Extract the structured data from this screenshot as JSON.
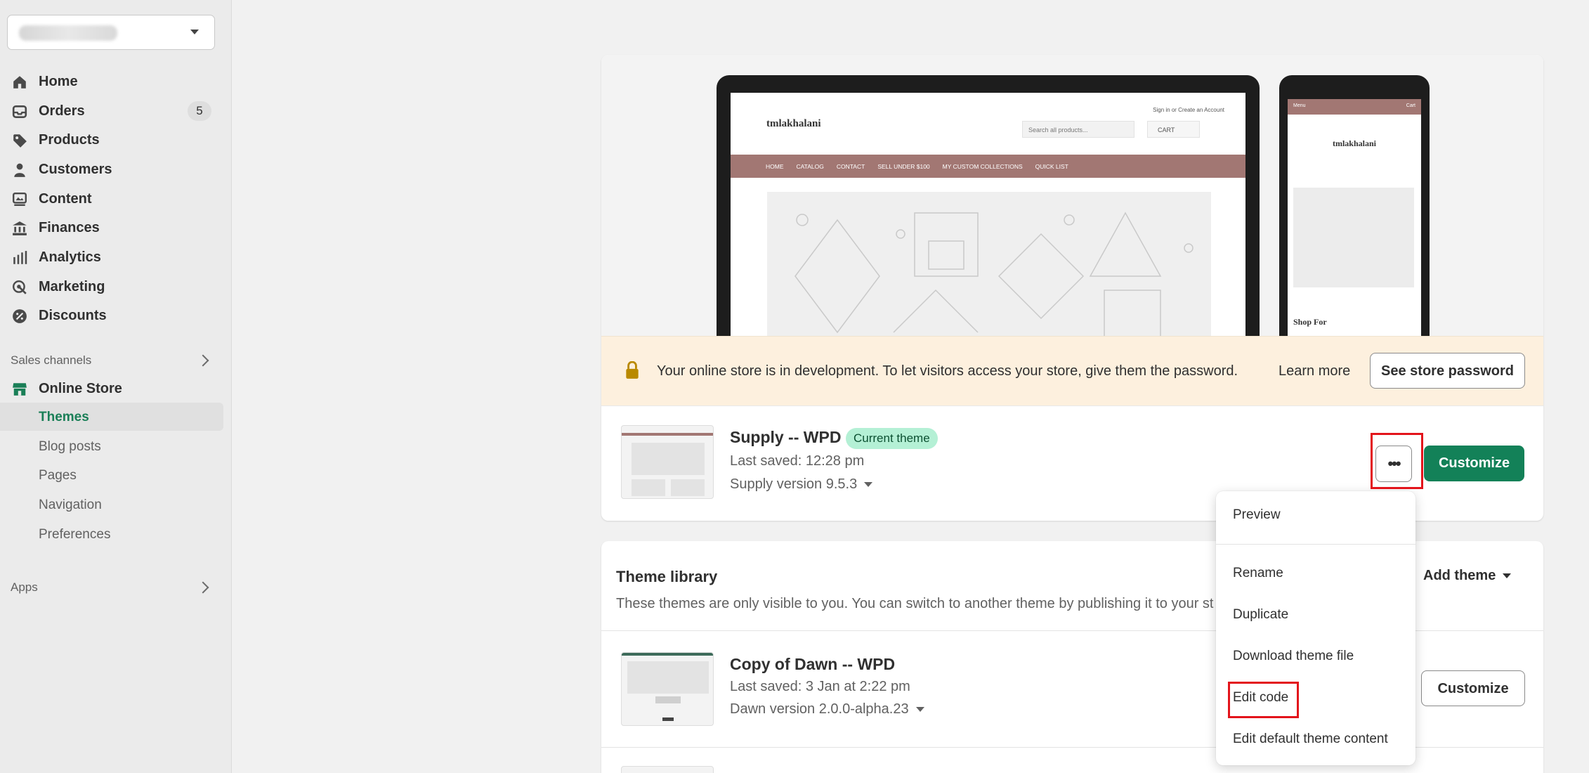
{
  "sidebar": {
    "store_selector": {
      "value": ""
    },
    "nav": [
      {
        "label": "Home",
        "icon": "home-icon"
      },
      {
        "label": "Orders",
        "icon": "inbox-icon",
        "badge": "5"
      },
      {
        "label": "Products",
        "icon": "tag-icon"
      },
      {
        "label": "Customers",
        "icon": "person-icon"
      },
      {
        "label": "Content",
        "icon": "image-icon"
      },
      {
        "label": "Finances",
        "icon": "bank-icon"
      },
      {
        "label": "Analytics",
        "icon": "bar-chart-icon"
      },
      {
        "label": "Marketing",
        "icon": "target-icon"
      },
      {
        "label": "Discounts",
        "icon": "discount-icon"
      }
    ],
    "sales_channels_label": "Sales channels",
    "online_store": {
      "label": "Online Store",
      "icon": "store-icon",
      "accent": "#1a7f57",
      "subitems": [
        "Themes",
        "Blog posts",
        "Pages",
        "Navigation",
        "Preferences"
      ],
      "active": "Themes"
    },
    "apps_label": "Apps"
  },
  "preview": {
    "store_name": "tmlakhalani",
    "top_links": "Sign in  or  Create an Account",
    "search_placeholder": "Search all products...",
    "cart_label": "CART",
    "menu": [
      "HOME",
      "CATALOG",
      "CONTACT",
      "SELL UNDER $100",
      "MY CUSTOM COLLECTIONS",
      "QUICK LIST"
    ],
    "phone_menu": "Menu",
    "phone_cart": "Cart",
    "phone_shop_for": "Shop For",
    "accent": "#a27773"
  },
  "dev_banner": {
    "text": "Your online store is in development. To let visitors access your store, give them the password.",
    "learn_more": "Learn more",
    "button": "See store password",
    "background": "#fdf0de"
  },
  "current_theme": {
    "name": "Supply -- WPD",
    "badge": "Current theme",
    "last_saved": "Last saved: 12:28 pm",
    "version": "Supply version 9.5.3",
    "more_label": "•••",
    "customize": "Customize",
    "primary_color": "#138158"
  },
  "library": {
    "title": "Theme library",
    "subtitle": "These themes are only visible to you. You can switch to another theme by publishing it to your st",
    "add_theme": "Add theme",
    "themes": [
      {
        "name": "Copy of Dawn -- WPD",
        "last_saved": "Last saved: 3 Jan at 2:22 pm",
        "version": "Dawn version 2.0.0-alpha.23",
        "customize": "Customize"
      }
    ]
  },
  "menu": {
    "items": [
      "Preview",
      "Rename",
      "Duplicate",
      "Download theme file",
      "Edit code",
      "Edit default theme content"
    ]
  },
  "highlight_color": "#e3141b"
}
